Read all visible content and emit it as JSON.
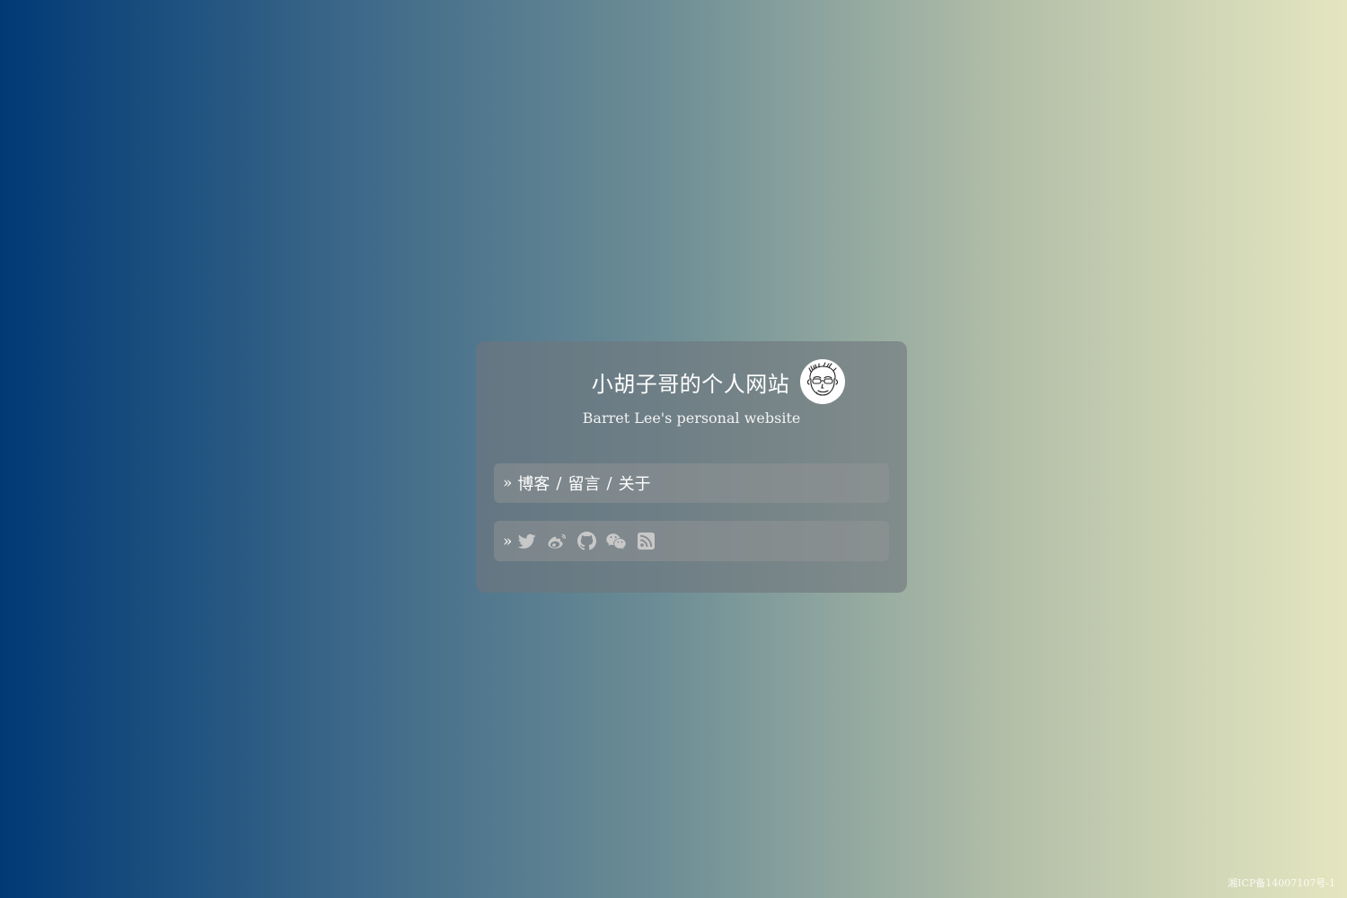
{
  "site": {
    "title": "小胡子哥的个人网站",
    "subtitle": "Barret Lee's personal website"
  },
  "nav": {
    "prefix": "»",
    "separator": "/",
    "links": [
      "博客",
      "留言",
      "关于"
    ]
  },
  "social": {
    "prefix": "»",
    "icons": [
      "twitter-icon",
      "weibo-icon",
      "github-icon",
      "wechat-icon",
      "rss-icon"
    ],
    "icon_color": "#c8c8c8"
  },
  "footer": {
    "icp": "湘ICP备14007107号-1"
  }
}
